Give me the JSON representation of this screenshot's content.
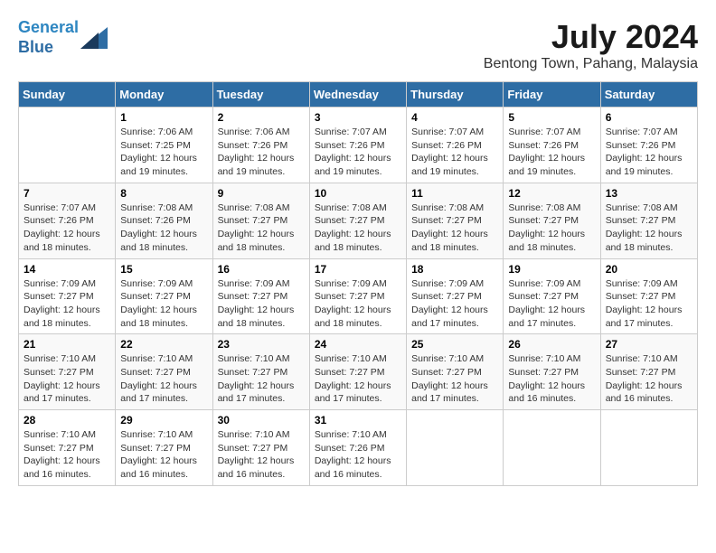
{
  "logo": {
    "line1": "General",
    "line2": "Blue"
  },
  "title": "July 2024",
  "location": "Bentong Town, Pahang, Malaysia",
  "days_of_week": [
    "Sunday",
    "Monday",
    "Tuesday",
    "Wednesday",
    "Thursday",
    "Friday",
    "Saturday"
  ],
  "weeks": [
    [
      {
        "day": "",
        "info": ""
      },
      {
        "day": "1",
        "info": "Sunrise: 7:06 AM\nSunset: 7:25 PM\nDaylight: 12 hours and 19 minutes."
      },
      {
        "day": "2",
        "info": "Sunrise: 7:06 AM\nSunset: 7:26 PM\nDaylight: 12 hours and 19 minutes."
      },
      {
        "day": "3",
        "info": "Sunrise: 7:07 AM\nSunset: 7:26 PM\nDaylight: 12 hours and 19 minutes."
      },
      {
        "day": "4",
        "info": "Sunrise: 7:07 AM\nSunset: 7:26 PM\nDaylight: 12 hours and 19 minutes."
      },
      {
        "day": "5",
        "info": "Sunrise: 7:07 AM\nSunset: 7:26 PM\nDaylight: 12 hours and 19 minutes."
      },
      {
        "day": "6",
        "info": "Sunrise: 7:07 AM\nSunset: 7:26 PM\nDaylight: 12 hours and 19 minutes."
      }
    ],
    [
      {
        "day": "7",
        "info": "Sunrise: 7:07 AM\nSunset: 7:26 PM\nDaylight: 12 hours and 18 minutes."
      },
      {
        "day": "8",
        "info": "Sunrise: 7:08 AM\nSunset: 7:26 PM\nDaylight: 12 hours and 18 minutes."
      },
      {
        "day": "9",
        "info": "Sunrise: 7:08 AM\nSunset: 7:27 PM\nDaylight: 12 hours and 18 minutes."
      },
      {
        "day": "10",
        "info": "Sunrise: 7:08 AM\nSunset: 7:27 PM\nDaylight: 12 hours and 18 minutes."
      },
      {
        "day": "11",
        "info": "Sunrise: 7:08 AM\nSunset: 7:27 PM\nDaylight: 12 hours and 18 minutes."
      },
      {
        "day": "12",
        "info": "Sunrise: 7:08 AM\nSunset: 7:27 PM\nDaylight: 12 hours and 18 minutes."
      },
      {
        "day": "13",
        "info": "Sunrise: 7:08 AM\nSunset: 7:27 PM\nDaylight: 12 hours and 18 minutes."
      }
    ],
    [
      {
        "day": "14",
        "info": "Sunrise: 7:09 AM\nSunset: 7:27 PM\nDaylight: 12 hours and 18 minutes."
      },
      {
        "day": "15",
        "info": "Sunrise: 7:09 AM\nSunset: 7:27 PM\nDaylight: 12 hours and 18 minutes."
      },
      {
        "day": "16",
        "info": "Sunrise: 7:09 AM\nSunset: 7:27 PM\nDaylight: 12 hours and 18 minutes."
      },
      {
        "day": "17",
        "info": "Sunrise: 7:09 AM\nSunset: 7:27 PM\nDaylight: 12 hours and 18 minutes."
      },
      {
        "day": "18",
        "info": "Sunrise: 7:09 AM\nSunset: 7:27 PM\nDaylight: 12 hours and 17 minutes."
      },
      {
        "day": "19",
        "info": "Sunrise: 7:09 AM\nSunset: 7:27 PM\nDaylight: 12 hours and 17 minutes."
      },
      {
        "day": "20",
        "info": "Sunrise: 7:09 AM\nSunset: 7:27 PM\nDaylight: 12 hours and 17 minutes."
      }
    ],
    [
      {
        "day": "21",
        "info": "Sunrise: 7:10 AM\nSunset: 7:27 PM\nDaylight: 12 hours and 17 minutes."
      },
      {
        "day": "22",
        "info": "Sunrise: 7:10 AM\nSunset: 7:27 PM\nDaylight: 12 hours and 17 minutes."
      },
      {
        "day": "23",
        "info": "Sunrise: 7:10 AM\nSunset: 7:27 PM\nDaylight: 12 hours and 17 minutes."
      },
      {
        "day": "24",
        "info": "Sunrise: 7:10 AM\nSunset: 7:27 PM\nDaylight: 12 hours and 17 minutes."
      },
      {
        "day": "25",
        "info": "Sunrise: 7:10 AM\nSunset: 7:27 PM\nDaylight: 12 hours and 17 minutes."
      },
      {
        "day": "26",
        "info": "Sunrise: 7:10 AM\nSunset: 7:27 PM\nDaylight: 12 hours and 16 minutes."
      },
      {
        "day": "27",
        "info": "Sunrise: 7:10 AM\nSunset: 7:27 PM\nDaylight: 12 hours and 16 minutes."
      }
    ],
    [
      {
        "day": "28",
        "info": "Sunrise: 7:10 AM\nSunset: 7:27 PM\nDaylight: 12 hours and 16 minutes."
      },
      {
        "day": "29",
        "info": "Sunrise: 7:10 AM\nSunset: 7:27 PM\nDaylight: 12 hours and 16 minutes."
      },
      {
        "day": "30",
        "info": "Sunrise: 7:10 AM\nSunset: 7:27 PM\nDaylight: 12 hours and 16 minutes."
      },
      {
        "day": "31",
        "info": "Sunrise: 7:10 AM\nSunset: 7:26 PM\nDaylight: 12 hours and 16 minutes."
      },
      {
        "day": "",
        "info": ""
      },
      {
        "day": "",
        "info": ""
      },
      {
        "day": "",
        "info": ""
      }
    ]
  ]
}
